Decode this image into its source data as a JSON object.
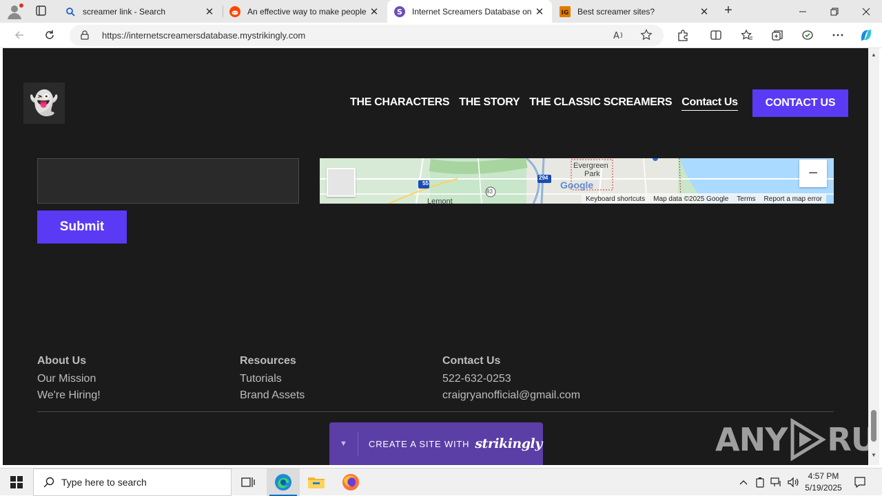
{
  "browser": {
    "tabs": [
      {
        "title": "screamer link - Search",
        "icon": "search-icon"
      },
      {
        "title": "An effective way to make people",
        "icon": "reddit-icon"
      },
      {
        "title": "Internet Screamers Database on S",
        "icon": "strikingly-icon"
      },
      {
        "title": "Best screamer sites?",
        "icon": "forum-icon"
      }
    ],
    "url": "https://internetscreamersdatabase.mystrikingly.com"
  },
  "site": {
    "logo_emoji": "👻",
    "nav": [
      "THE CHARACTERS",
      "THE STORY",
      "THE CLASSIC SCREAMERS",
      "Contact Us"
    ],
    "cta": "CONTACT US",
    "form": {
      "submit": "Submit"
    },
    "map": {
      "labels": [
        "Evergreen",
        "Park",
        "Lemont",
        "Google"
      ],
      "route_shields": [
        "55",
        "294",
        "83"
      ],
      "footer_links": [
        "Keyboard shortcuts",
        "Map data ©2025 Google",
        "Terms",
        "Report a map error"
      ],
      "zoom_out": "−"
    },
    "footer": {
      "columns": [
        {
          "heading": "About Us",
          "items": [
            "Our Mission",
            "We're Hiring!"
          ]
        },
        {
          "heading": "Resources",
          "items": [
            "Tutorials",
            "Brand Assets"
          ]
        },
        {
          "heading": "Contact Us",
          "items": [
            "522-632-0253",
            "craigryanofficial@gmail.com"
          ]
        }
      ]
    },
    "badge": {
      "text": "CREATE A SITE WITH",
      "brand": "strikingly"
    },
    "watermark": {
      "left": "ANY",
      "right": "RUN"
    }
  },
  "taskbar": {
    "search_placeholder": "Type here to search",
    "time": "4:57 PM",
    "date": "5/19/2025"
  },
  "colors": {
    "accent": "#5a3af5",
    "page_bg": "#1c1b1c",
    "badge": "#5b3ea6"
  }
}
